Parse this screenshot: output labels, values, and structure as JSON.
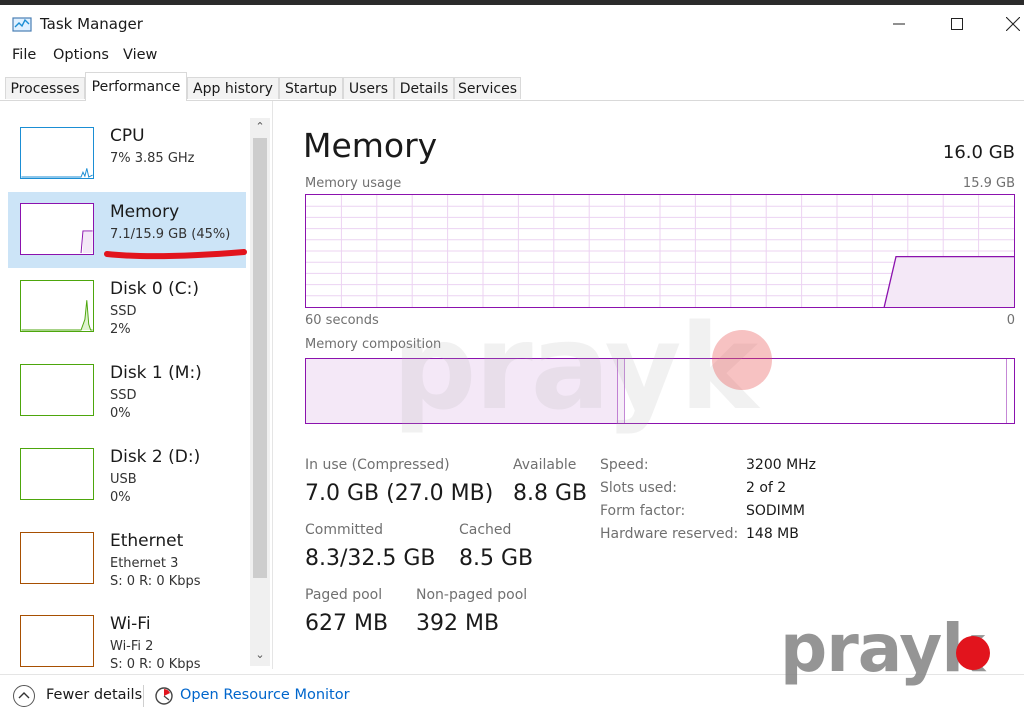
{
  "window": {
    "title": "Task Manager"
  },
  "menu": [
    "File",
    "Options",
    "View"
  ],
  "tabs": [
    {
      "label": "Processes"
    },
    {
      "label": "Performance",
      "active": true
    },
    {
      "label": "App history"
    },
    {
      "label": "Startup"
    },
    {
      "label": "Users"
    },
    {
      "label": "Details"
    },
    {
      "label": "Services"
    }
  ],
  "sidebar": {
    "items": [
      {
        "name": "CPU",
        "line1": "7%  3.85 GHz",
        "line2": "",
        "color": "#1b8ed4"
      },
      {
        "name": "Memory",
        "line1": "7.1/15.9 GB (45%)",
        "line2": "",
        "color": "#8b12ae",
        "selected": true
      },
      {
        "name": "Disk 0 (C:)",
        "line1": "SSD",
        "line2": "2%",
        "color": "#4da60c"
      },
      {
        "name": "Disk 1 (M:)",
        "line1": "SSD",
        "line2": "0%",
        "color": "#4da60c"
      },
      {
        "name": "Disk 2 (D:)",
        "line1": "USB",
        "line2": "0%",
        "color": "#4da60c"
      },
      {
        "name": "Ethernet",
        "line1": "Ethernet 3",
        "line2": "S: 0  R: 0 Kbps",
        "color": "#a74f01"
      },
      {
        "name": "Wi-Fi",
        "line1": "Wi-Fi 2",
        "line2": "S: 0  R: 0 Kbps",
        "color": "#a74f01"
      }
    ]
  },
  "main": {
    "title": "Memory",
    "total": "16.0 GB",
    "usage_label": "Memory usage",
    "usage_max": "15.9 GB",
    "time_left": "60 seconds",
    "time_right": "0",
    "composition_label": "Memory composition",
    "usage_history": [
      0,
      0,
      0,
      0,
      0,
      0,
      0,
      0,
      0,
      0,
      0,
      0,
      0,
      0,
      0,
      0,
      0,
      0,
      0,
      0,
      0,
      0,
      0,
      0,
      0,
      0,
      0,
      0,
      0,
      0,
      0,
      0,
      0,
      0,
      0,
      0,
      0,
      0,
      0,
      0,
      0,
      0,
      0,
      0,
      0,
      0,
      0,
      0,
      0,
      0,
      0.45,
      0.45,
      0.45,
      0.45,
      0.45,
      0.45,
      0.45,
      0.45,
      0.45,
      0.45,
      0.45
    ],
    "composition": {
      "in_use": 0.44,
      "modified": 0.01,
      "standby": 0.54,
      "free": 0.01
    },
    "stats": {
      "in_use_label": "In use (Compressed)",
      "in_use_value": "7.0 GB (27.0 MB)",
      "available_label": "Available",
      "available_value": "8.8 GB",
      "committed_label": "Committed",
      "committed_value": "8.3/32.5 GB",
      "cached_label": "Cached",
      "cached_value": "8.5 GB",
      "paged_label": "Paged pool",
      "paged_value": "627 MB",
      "nonpaged_label": "Non-paged pool",
      "nonpaged_value": "392 MB"
    },
    "details": [
      {
        "key": "Speed:",
        "value": "3200 MHz"
      },
      {
        "key": "Slots used:",
        "value": "2 of 2"
      },
      {
        "key": "Form factor:",
        "value": "SODIMM"
      },
      {
        "key": "Hardware reserved:",
        "value": "148 MB"
      }
    ]
  },
  "footer": {
    "fewer_details": "Fewer details",
    "open_monitor": "Open Resource Monitor"
  },
  "watermark": {
    "text": "prayk"
  },
  "colors": {
    "memory": "#8b12ae",
    "memory_fill": "#f4e8f7",
    "selected_bg": "#cce4f7",
    "link": "#0066cc"
  }
}
